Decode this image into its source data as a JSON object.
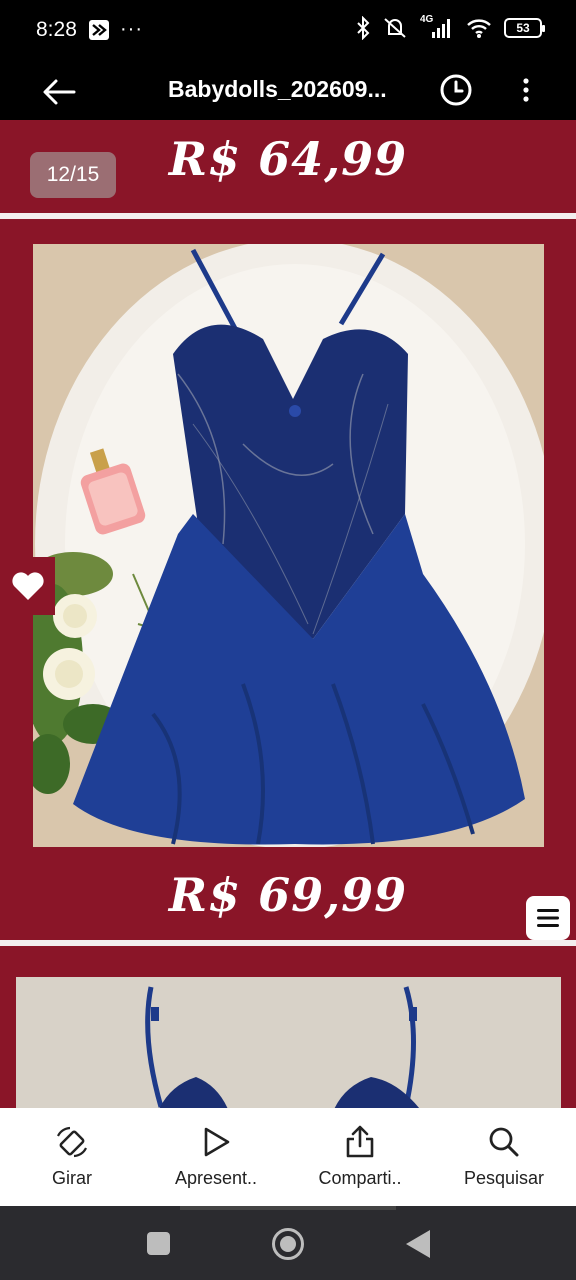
{
  "status_bar": {
    "time": "8:28",
    "battery": "53",
    "network": "4G",
    "left_icons": [
      "app-notification-icon",
      "more-dots-icon"
    ],
    "right_icons": [
      "bluetooth-icon",
      "mute-vibrate-icon",
      "signal-icon",
      "wifi-icon",
      "battery-icon"
    ]
  },
  "app_bar": {
    "title": "Babydolls_202609...",
    "back_icon": "arrow-left-icon",
    "history_icon": "clock-icon",
    "more_icon": "more-vertical-icon"
  },
  "viewer": {
    "page_counter": "12/15",
    "price_top": "R$ 64,99",
    "price_main": "R$ 69,99",
    "background_color": "#8a1528"
  },
  "toolbar": {
    "items": [
      {
        "label": "Girar",
        "icon": "rotate-icon"
      },
      {
        "label": "Apresent..",
        "icon": "play-icon"
      },
      {
        "label": "Comparti..",
        "icon": "share-icon"
      },
      {
        "label": "Pesquisar",
        "icon": "search-icon"
      }
    ]
  }
}
